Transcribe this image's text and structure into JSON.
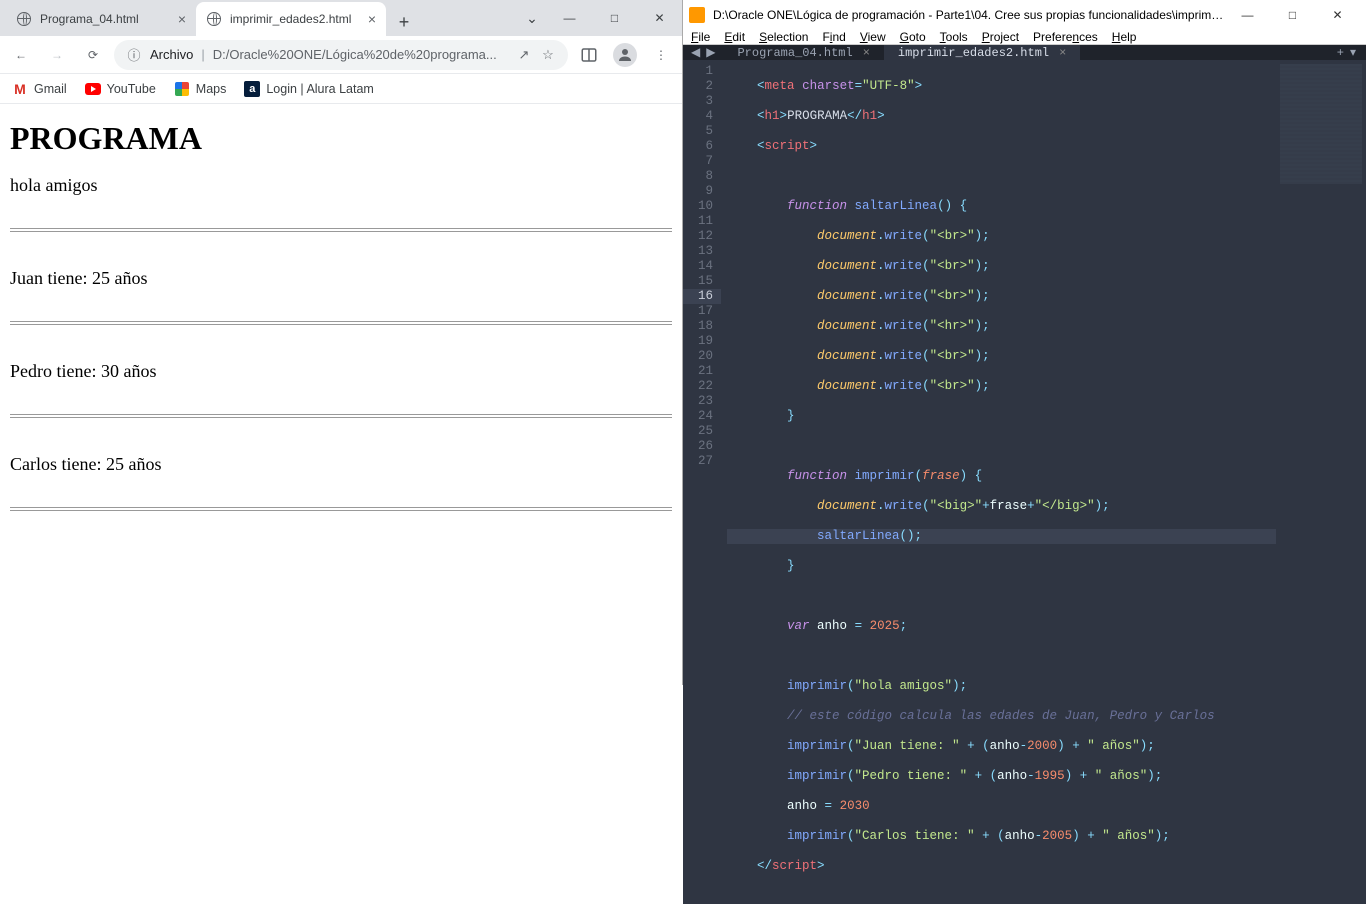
{
  "chrome": {
    "tabs": [
      {
        "title": "Programa_04.html"
      },
      {
        "title": "imprimir_edades2.html"
      }
    ],
    "newtab": "+",
    "dropdown": "⌄",
    "win": {
      "min": "—",
      "max": "□",
      "close": "✕"
    },
    "nav": {
      "back": "←",
      "fwd": "→",
      "reload": "⟳"
    },
    "omni": {
      "prefix": "Archivo",
      "sep": "|",
      "url": "D:/Oracle%20ONE/Lógica%20de%20programa..."
    },
    "actions": {
      "share": "↗",
      "star": "☆",
      "panel": "▭",
      "menu": "⋮"
    },
    "bookmarks": [
      {
        "icon": "gmail",
        "label": "Gmail"
      },
      {
        "icon": "youtube",
        "label": "YouTube"
      },
      {
        "icon": "maps",
        "label": "Maps"
      },
      {
        "icon": "alura",
        "label": "Login | Alura Latam"
      }
    ],
    "page": {
      "h1": "PROGRAMA",
      "lines": [
        "hola amigos",
        "Juan tiene: 25 años",
        "Pedro tiene: 30 años",
        "Carlos tiene: 25 años"
      ]
    }
  },
  "sublime": {
    "title": "D:\\Oracle ONE\\Lógica de programación - Parte1\\04. Cree sus propias funcionalidades\\imprimir...",
    "win": {
      "min": "—",
      "max": "□",
      "close": "✕"
    },
    "menu": [
      "File",
      "Edit",
      "Selection",
      "Find",
      "View",
      "Goto",
      "Tools",
      "Project",
      "Preferences",
      "Help"
    ],
    "nav": {
      "back": "◀",
      "fwd": "▶"
    },
    "tabs": [
      {
        "title": "Programa_04.html",
        "close": "×"
      },
      {
        "title": "imprimir_edades2.html",
        "close": "×"
      }
    ],
    "add": {
      "plus": "+",
      "dd": "▾"
    },
    "active_line": 16,
    "code": {
      "l1": {
        "indent": "    ",
        "a": "meta",
        "b": "charset",
        "c": "\"UTF-8\""
      },
      "l2": {
        "indent": "    ",
        "a": "h1",
        "t": "PROGRAMA"
      },
      "l3": {
        "indent": "    ",
        "a": "script"
      },
      "l5": {
        "kw": "function",
        "fn": "saltarLinea"
      },
      "dw": {
        "obj": "document",
        "m": "write",
        "s": "\"<br>\""
      },
      "dwhr": {
        "obj": "document",
        "m": "write",
        "s": "\"<hr>\""
      },
      "l14": {
        "kw": "function",
        "fn": "imprimir",
        "p": "frase"
      },
      "l15": {
        "obj": "document",
        "m": "write",
        "s1": "\"<big>\"",
        "v": "frase",
        "s2": "\"</big>\""
      },
      "l16": {
        "fn": "saltarLinea"
      },
      "l19": {
        "kw": "var",
        "v": "anho",
        "n": "2025"
      },
      "l20": {
        "fn": "imprimir",
        "s": "\"hola amigos\""
      },
      "l21": {
        "cmt": "// este código calcula las edades de Juan, Pedro y Carlos"
      },
      "l22": {
        "fn": "imprimir",
        "s1": "\"Juan tiene: \"",
        "v": "anho",
        "n": "2000",
        "s2": "\" años\""
      },
      "l23": {
        "fn": "imprimir",
        "s1": "\"Pedro tiene: \"",
        "v": "anho",
        "n": "1995",
        "s2": "\" años\""
      },
      "l24": {
        "v": "anho",
        "n": "2030"
      },
      "l25": {
        "fn": "imprimir",
        "s1": "\"Carlos tiene: \"",
        "v": "anho",
        "n": "2005",
        "s2": "\" años\""
      },
      "l26": {
        "a": "script"
      }
    }
  }
}
